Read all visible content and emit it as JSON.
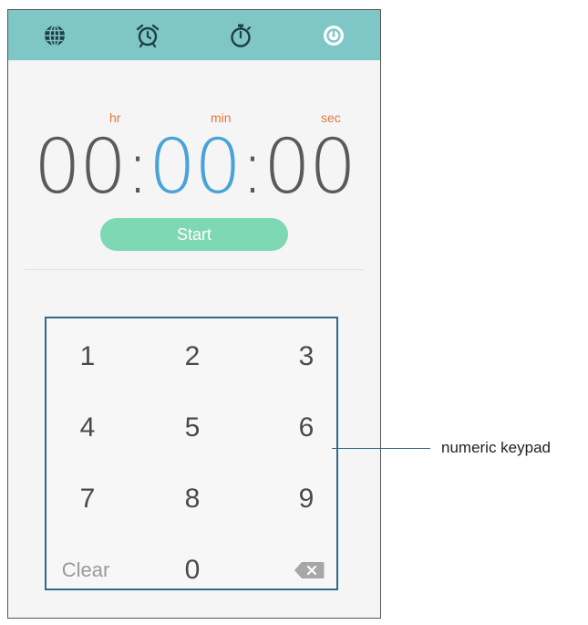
{
  "tabs": [
    {
      "icon": "globe-icon"
    },
    {
      "icon": "alarm-clock-icon"
    },
    {
      "icon": "stopwatch-icon"
    },
    {
      "icon": "timer-icon"
    }
  ],
  "timer": {
    "labels": {
      "hr": "hr",
      "min": "min",
      "sec": "sec"
    },
    "hours": "00",
    "minutes": "00",
    "seconds": "00",
    "selected_field": "minutes"
  },
  "start_label": "Start",
  "keypad": {
    "keys": [
      "1",
      "2",
      "3",
      "4",
      "5",
      "6",
      "7",
      "8",
      "9"
    ],
    "clear_label": "Clear",
    "zero": "0",
    "backspace_icon": "backspace-icon"
  },
  "callout": "numeric keypad",
  "colors": {
    "tabbar": "#7fc6c7",
    "start_button": "#7fd8b4",
    "unit_label": "#e0793c",
    "selected_digits": "#49a3d8",
    "keypad_border": "#2f6b8a"
  }
}
